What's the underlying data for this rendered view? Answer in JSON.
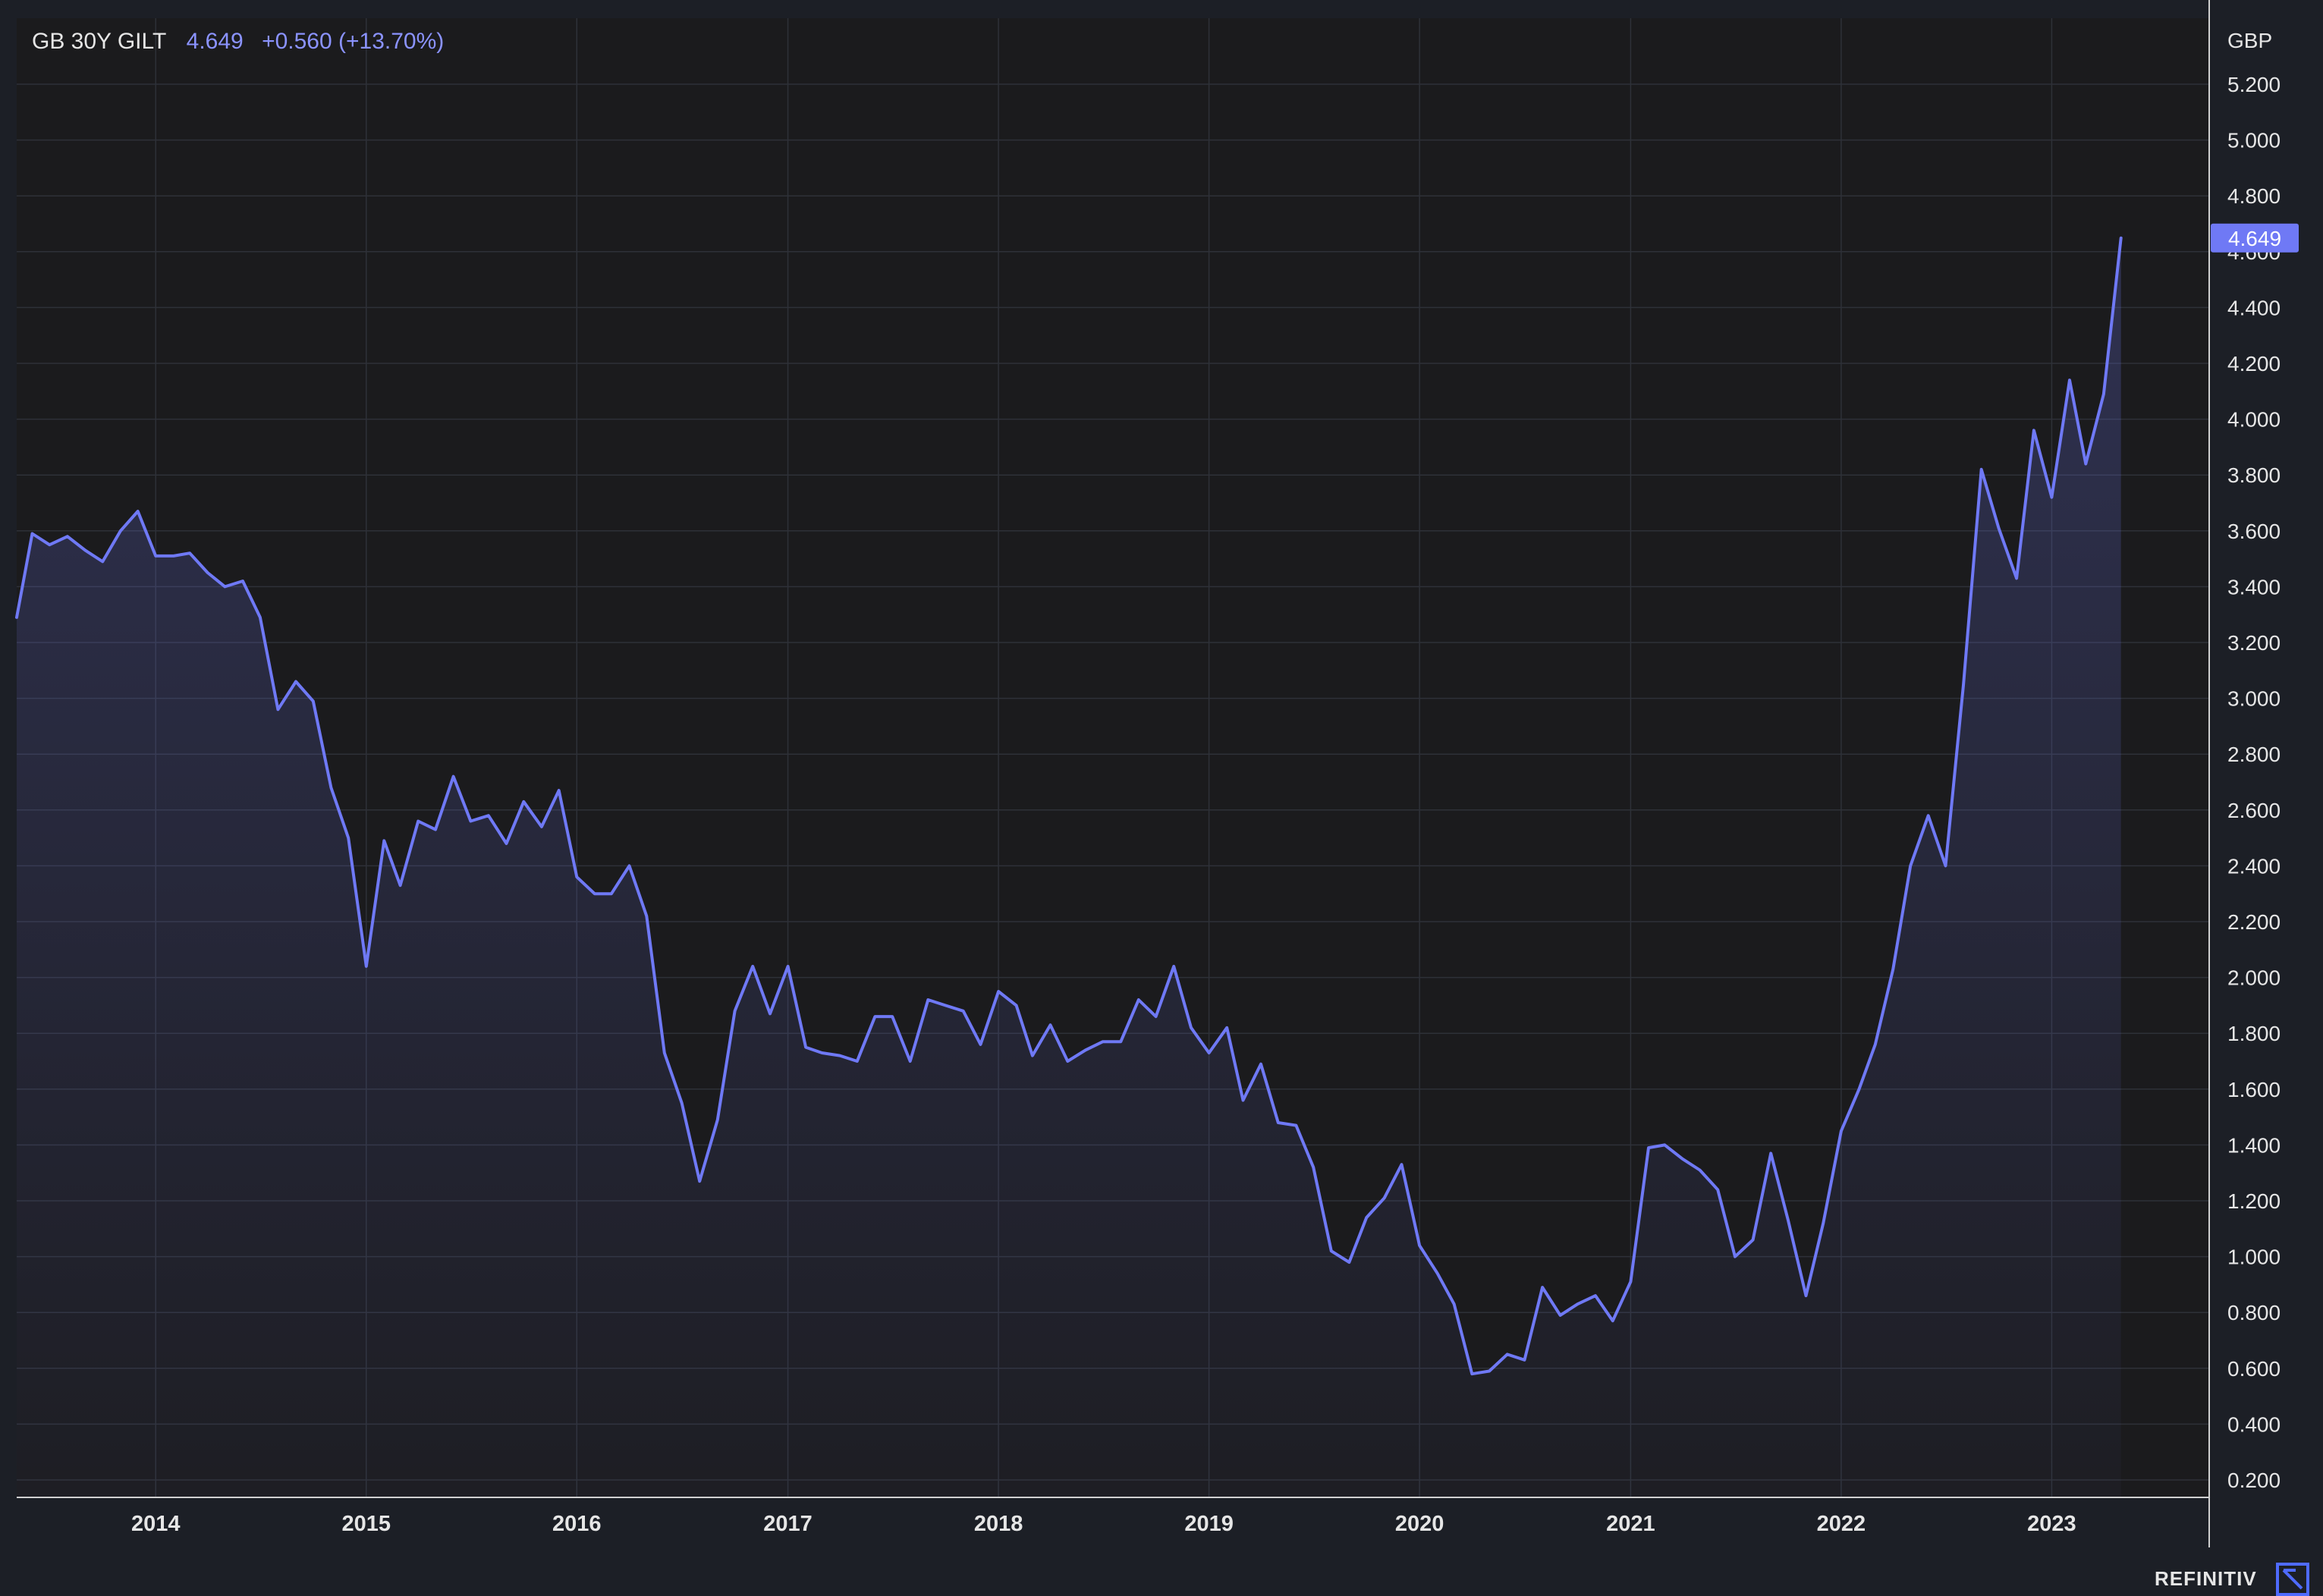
{
  "legend": {
    "symbol": "GB 30Y GILT",
    "value": "4.649",
    "change": "+0.560 (+13.70%)"
  },
  "brand": "REFINITIV",
  "icons": {
    "brand": "refinitiv-logo-icon"
  },
  "colors": {
    "background": "#1c1f26",
    "plot_background": "#1b1b1d",
    "line": "#6f79f5",
    "last_value_badge": "#6f79f5"
  },
  "chart_data": {
    "type": "area",
    "title": "",
    "ylabel": "GBP",
    "xlabel": "",
    "last_value_label": "4.649",
    "grid": true,
    "x_ticks": [
      "2014",
      "2015",
      "2016",
      "2017",
      "2018",
      "2019",
      "2020",
      "2021",
      "2022",
      "2023"
    ],
    "y_ticks": [
      0.2,
      0.4,
      0.6,
      0.8,
      1.0,
      1.2,
      1.4,
      1.6,
      1.8,
      2.0,
      2.2,
      2.4,
      2.6,
      2.8,
      3.0,
      3.2,
      3.4,
      3.6,
      3.8,
      4.0,
      4.2,
      4.4,
      4.6,
      4.8,
      5.0,
      5.2
    ],
    "y_tick_labels": [
      "0.200",
      "0.400",
      "0.600",
      "0.800",
      "1.000",
      "1.200",
      "1.400",
      "1.600",
      "1.800",
      "2.000",
      "2.200",
      "2.400",
      "2.600",
      "2.800",
      "3.000",
      "3.200",
      "3.400",
      "3.600",
      "3.800",
      "4.000",
      "4.200",
      "4.400",
      "4.600",
      "4.800",
      "5.000",
      "5.200"
    ],
    "xlim": [
      "2013-05-05",
      "2023-10-01"
    ],
    "ylim": [
      0.1,
      5.45
    ],
    "series": [
      {
        "values": [
          [
            "2013-05-05",
            3.29
          ],
          [
            "2013-06-01",
            3.59
          ],
          [
            "2013-07-01",
            3.55
          ],
          [
            "2013-08-01",
            3.58
          ],
          [
            "2013-09-01",
            3.53
          ],
          [
            "2013-10-01",
            3.49
          ],
          [
            "2013-11-01",
            3.6
          ],
          [
            "2013-12-01",
            3.67
          ],
          [
            "2014-01-01",
            3.51
          ],
          [
            "2014-02-01",
            3.51
          ],
          [
            "2014-03-01",
            3.52
          ],
          [
            "2014-04-01",
            3.45
          ],
          [
            "2014-05-01",
            3.4
          ],
          [
            "2014-06-01",
            3.42
          ],
          [
            "2014-07-01",
            3.29
          ],
          [
            "2014-08-01",
            2.96
          ],
          [
            "2014-09-01",
            3.06
          ],
          [
            "2014-10-01",
            2.99
          ],
          [
            "2014-11-01",
            2.68
          ],
          [
            "2014-12-01",
            2.5
          ],
          [
            "2015-01-01",
            2.04
          ],
          [
            "2015-02-01",
            2.49
          ],
          [
            "2015-03-01",
            2.33
          ],
          [
            "2015-04-01",
            2.56
          ],
          [
            "2015-05-01",
            2.53
          ],
          [
            "2015-06-01",
            2.72
          ],
          [
            "2015-07-01",
            2.56
          ],
          [
            "2015-08-01",
            2.58
          ],
          [
            "2015-09-01",
            2.48
          ],
          [
            "2015-10-01",
            2.63
          ],
          [
            "2015-11-01",
            2.54
          ],
          [
            "2015-12-01",
            2.67
          ],
          [
            "2016-01-01",
            2.36
          ],
          [
            "2016-02-01",
            2.3
          ],
          [
            "2016-03-01",
            2.3
          ],
          [
            "2016-04-01",
            2.4
          ],
          [
            "2016-05-01",
            2.22
          ],
          [
            "2016-06-01",
            1.73
          ],
          [
            "2016-07-01",
            1.55
          ],
          [
            "2016-08-01",
            1.27
          ],
          [
            "2016-09-01",
            1.49
          ],
          [
            "2016-10-01",
            1.88
          ],
          [
            "2016-11-01",
            2.04
          ],
          [
            "2016-12-01",
            1.87
          ],
          [
            "2017-01-01",
            2.04
          ],
          [
            "2017-02-01",
            1.75
          ],
          [
            "2017-03-01",
            1.73
          ],
          [
            "2017-04-01",
            1.72
          ],
          [
            "2017-05-01",
            1.7
          ],
          [
            "2017-06-01",
            1.86
          ],
          [
            "2017-07-01",
            1.86
          ],
          [
            "2017-08-01",
            1.7
          ],
          [
            "2017-09-01",
            1.92
          ],
          [
            "2017-10-01",
            1.9
          ],
          [
            "2017-11-01",
            1.88
          ],
          [
            "2017-12-01",
            1.76
          ],
          [
            "2018-01-01",
            1.95
          ],
          [
            "2018-02-01",
            1.9
          ],
          [
            "2018-03-01",
            1.72
          ],
          [
            "2018-04-01",
            1.83
          ],
          [
            "2018-05-01",
            1.7
          ],
          [
            "2018-06-01",
            1.74
          ],
          [
            "2018-07-01",
            1.77
          ],
          [
            "2018-08-01",
            1.77
          ],
          [
            "2018-09-01",
            1.92
          ],
          [
            "2018-10-01",
            1.86
          ],
          [
            "2018-11-01",
            2.04
          ],
          [
            "2018-12-01",
            1.82
          ],
          [
            "2019-01-01",
            1.73
          ],
          [
            "2019-02-01",
            1.82
          ],
          [
            "2019-03-01",
            1.56
          ],
          [
            "2019-04-01",
            1.69
          ],
          [
            "2019-05-01",
            1.48
          ],
          [
            "2019-06-01",
            1.47
          ],
          [
            "2019-07-01",
            1.32
          ],
          [
            "2019-08-01",
            1.02
          ],
          [
            "2019-09-01",
            0.98
          ],
          [
            "2019-10-01",
            1.14
          ],
          [
            "2019-11-01",
            1.21
          ],
          [
            "2019-12-01",
            1.33
          ],
          [
            "2020-01-01",
            1.04
          ],
          [
            "2020-02-01",
            0.94
          ],
          [
            "2020-03-01",
            0.83
          ],
          [
            "2020-04-01",
            0.58
          ],
          [
            "2020-05-01",
            0.59
          ],
          [
            "2020-06-01",
            0.65
          ],
          [
            "2020-07-01",
            0.63
          ],
          [
            "2020-08-01",
            0.89
          ],
          [
            "2020-09-01",
            0.79
          ],
          [
            "2020-10-01",
            0.83
          ],
          [
            "2020-11-01",
            0.86
          ],
          [
            "2020-12-01",
            0.77
          ],
          [
            "2021-01-01",
            0.91
          ],
          [
            "2021-02-01",
            1.39
          ],
          [
            "2021-03-01",
            1.4
          ],
          [
            "2021-04-01",
            1.35
          ],
          [
            "2021-05-01",
            1.31
          ],
          [
            "2021-06-01",
            1.24
          ],
          [
            "2021-07-01",
            1.0
          ],
          [
            "2021-08-01",
            1.06
          ],
          [
            "2021-09-01",
            1.37
          ],
          [
            "2021-10-01",
            1.13
          ],
          [
            "2021-11-01",
            0.86
          ],
          [
            "2021-12-01",
            1.12
          ],
          [
            "2022-01-01",
            1.45
          ],
          [
            "2022-02-01",
            1.6
          ],
          [
            "2022-03-01",
            1.76
          ],
          [
            "2022-04-01",
            2.03
          ],
          [
            "2022-05-01",
            2.4
          ],
          [
            "2022-06-01",
            2.58
          ],
          [
            "2022-07-01",
            2.4
          ],
          [
            "2022-08-01",
            3.05
          ],
          [
            "2022-09-01",
            3.82
          ],
          [
            "2022-10-01",
            3.61
          ],
          [
            "2022-11-01",
            3.43
          ],
          [
            "2022-12-01",
            3.96
          ],
          [
            "2023-01-01",
            3.72
          ],
          [
            "2023-02-01",
            4.14
          ],
          [
            "2023-03-01",
            3.84
          ],
          [
            "2023-04-01",
            4.09
          ],
          [
            "2023-05-01",
            4.649
          ]
        ]
      }
    ]
  }
}
